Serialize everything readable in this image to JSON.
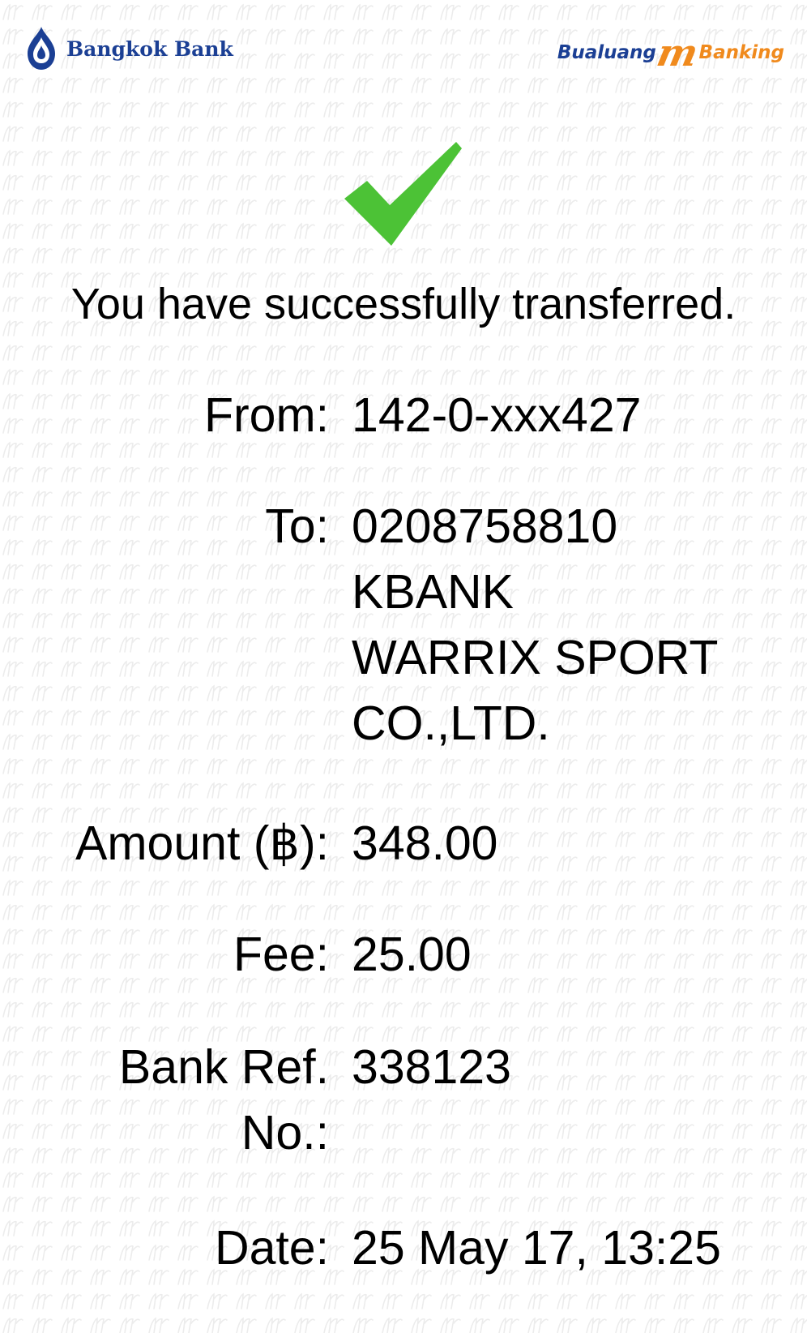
{
  "header": {
    "bank_name": "Bangkok Bank",
    "app_name_left": "Bualuang",
    "app_name_m": "m",
    "app_name_right": "Banking",
    "brand_blue": "#1b3f94",
    "brand_orange": "#f08a1d"
  },
  "status": {
    "icon": "checkmark-icon",
    "icon_color": "#4cc236",
    "title": "You have successfully transferred."
  },
  "from": {
    "label": "From:",
    "value": "142-0-xxx427"
  },
  "to": {
    "label": "To:",
    "account": "0208758810",
    "bank": "KBANK",
    "name_line1": "WARRIX SPORT",
    "name_line2": "CO.,LTD."
  },
  "amount": {
    "label": "Amount (฿):",
    "value": "348.00"
  },
  "fee": {
    "label": "Fee:",
    "value": "25.00"
  },
  "bank_ref": {
    "label_line1": "Bank Ref.",
    "label_line2": "No.:",
    "value": "338123"
  },
  "date": {
    "label": "Date:",
    "value": "25 May 17, 13:25"
  }
}
